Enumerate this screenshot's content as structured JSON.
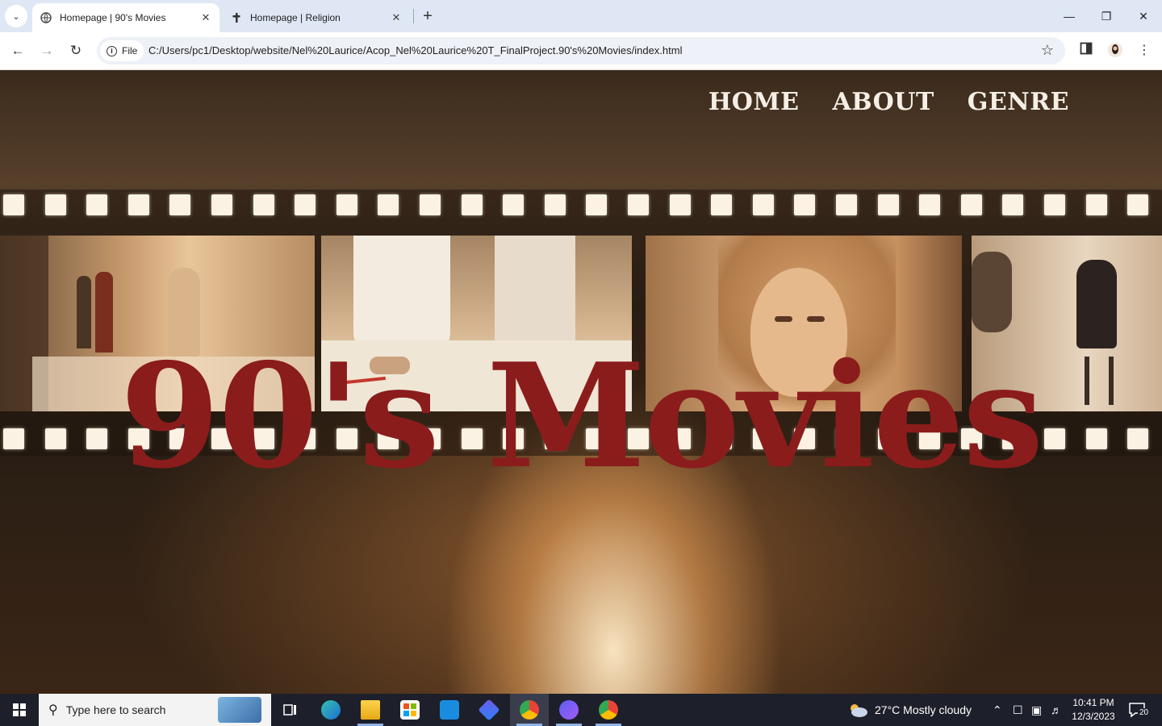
{
  "browser": {
    "tabs": [
      {
        "title": "Homepage | 90's Movies",
        "active": true
      },
      {
        "title": "Homepage | Religion",
        "active": false
      }
    ],
    "new_tab": "+",
    "address": {
      "chip_label": "File",
      "url": "C:/Users/pc1/Desktop/website/Nel%20Laurice/Acop_Nel%20Laurice%20T_FinalProject.90's%20Movies/index.html"
    }
  },
  "page": {
    "nav": [
      "HOME",
      "ABOUT",
      "GENRE"
    ],
    "hero_title": "90's Movies"
  },
  "taskbar": {
    "search_placeholder": "Type here to search",
    "weather": "27°C  Mostly cloudy",
    "time": "10:41 PM",
    "date": "12/3/2023",
    "notification_count": "20"
  },
  "colors": {
    "hero_title": "#8b1c1c",
    "nav_text": "#f6efe6",
    "tabbar_bg": "#dfe7f5",
    "taskbar_bg": "#1d1f2a"
  }
}
